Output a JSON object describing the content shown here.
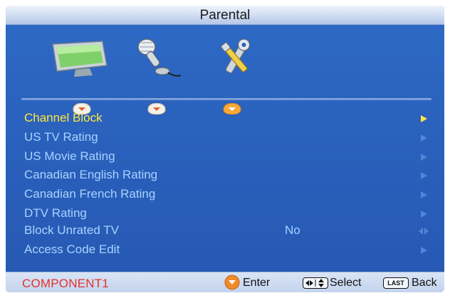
{
  "header": {
    "title": "Parental"
  },
  "tabs": [
    {
      "icon": "tv-monitor-icon"
    },
    {
      "icon": "microphone-icon"
    },
    {
      "icon": "wrench-tools-icon"
    }
  ],
  "menu": {
    "items": [
      {
        "label": "Channel Block",
        "value": "",
        "control": "arrow-right",
        "selected": true
      },
      {
        "label": "US TV Rating",
        "value": "",
        "control": "arrow-right"
      },
      {
        "label": "US Movie Rating",
        "value": "",
        "control": "arrow-right"
      },
      {
        "label": "Canadian English Rating",
        "value": "",
        "control": "arrow-right"
      },
      {
        "label": "Canadian French Rating",
        "value": "",
        "control": "arrow-right"
      },
      {
        "label": "DTV Rating",
        "value": "",
        "control": "arrow-right"
      },
      {
        "label": "Block Unrated TV",
        "value": "No",
        "control": "arrow-left-right"
      },
      {
        "label": "Access Code Edit",
        "value": "",
        "control": "arrow-right"
      }
    ]
  },
  "footer": {
    "source": "COMPONENT1",
    "enter_label": "Enter",
    "select_label": "Select",
    "last_key": "LAST",
    "back_label": "Back"
  },
  "colors": {
    "background": "#2a62bd",
    "menu_text": "#a8d2ff",
    "selected_text": "#ffe640",
    "source_text": "#e3332a"
  }
}
